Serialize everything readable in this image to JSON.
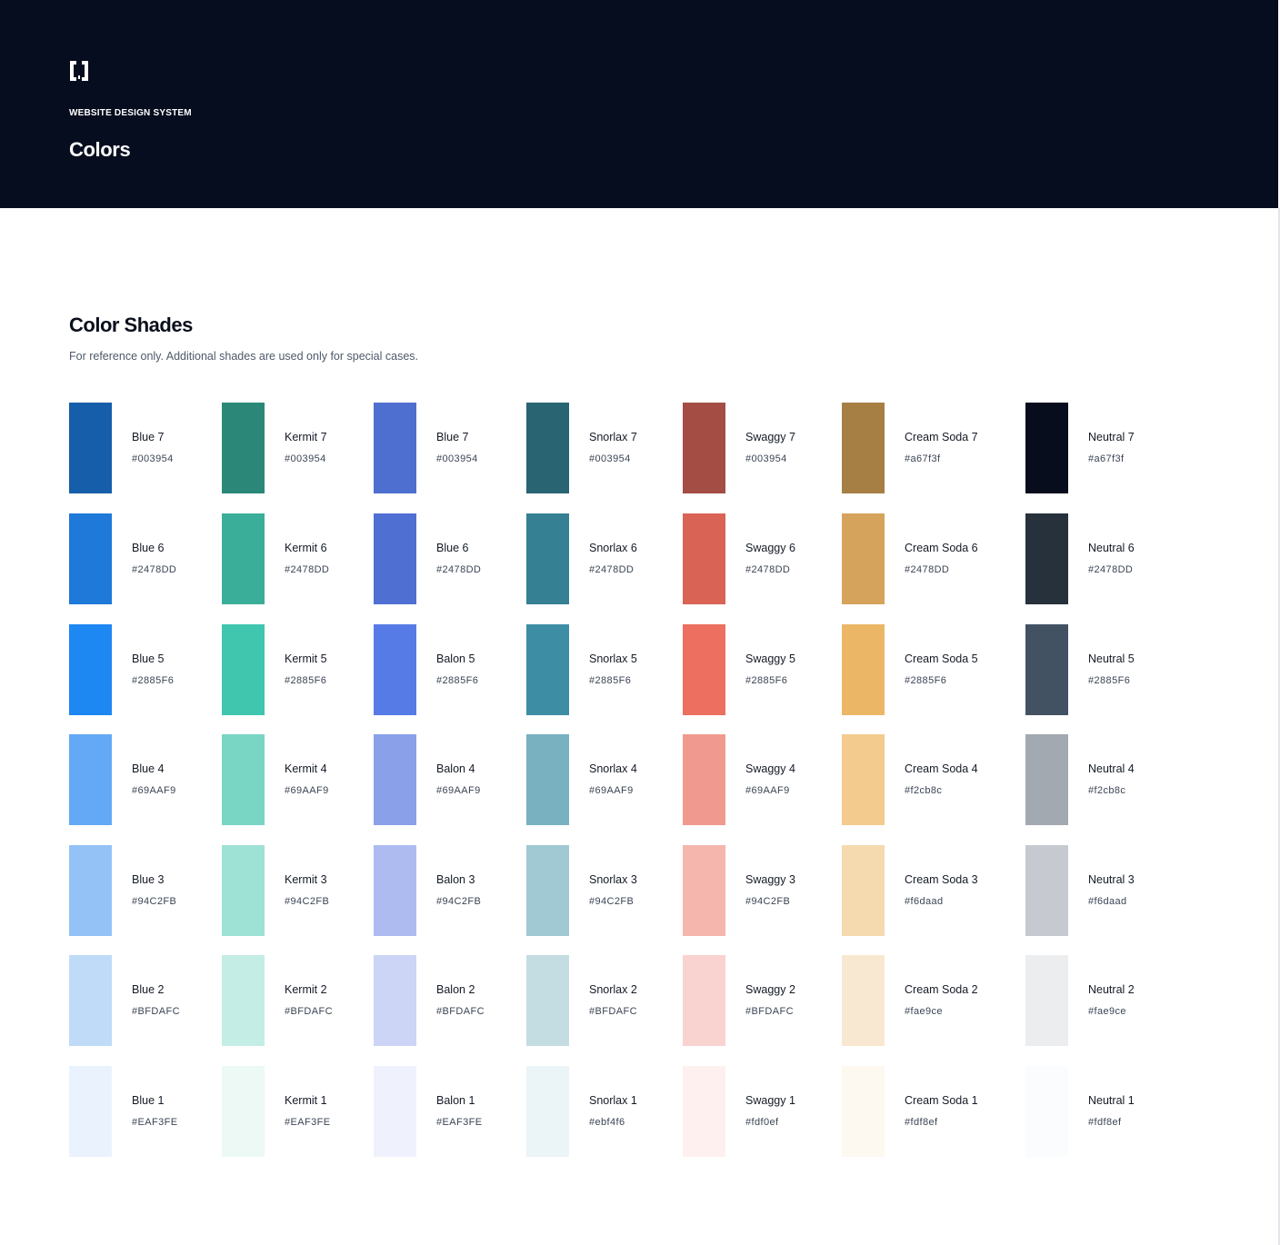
{
  "header": {
    "eyebrow": "WEBSITE DESIGN SYSTEM",
    "title": "Colors",
    "logo_icon": "brackets-logo-icon",
    "background_color": "#060d1f"
  },
  "section": {
    "title": "Color Shades",
    "description": "For reference only. Additional shades are used only for special cases."
  },
  "palette": {
    "columns": [
      {
        "family": "Blue",
        "shades": [
          {
            "name": "Blue 7",
            "hex": "#003954",
            "swatch_color": "#175EAA"
          },
          {
            "name": "Blue 6",
            "hex": "#2478DD",
            "swatch_color": "#1E79D8"
          },
          {
            "name": "Blue 5",
            "hex": "#2885F6",
            "swatch_color": "#1D87F2"
          },
          {
            "name": "Blue 4",
            "hex": "#69AAF9",
            "swatch_color": "#64A9F5"
          },
          {
            "name": "Blue 3",
            "hex": "#94C2FB",
            "swatch_color": "#94C2F7"
          },
          {
            "name": "Blue 2",
            "hex": "#BFDAFC",
            "swatch_color": "#C0DBF8"
          },
          {
            "name": "Blue 1",
            "hex": "#EAF3FE",
            "swatch_color": "#EAF3FD"
          }
        ]
      },
      {
        "family": "Kermit",
        "shades": [
          {
            "name": "Kermit 7",
            "hex": "#003954",
            "swatch_color": "#2B8878"
          },
          {
            "name": "Kermit 6",
            "hex": "#2478DD",
            "swatch_color": "#3BAE9A"
          },
          {
            "name": "Kermit 5",
            "hex": "#2885F6",
            "swatch_color": "#40C5AE"
          },
          {
            "name": "Kermit 4",
            "hex": "#69AAF9",
            "swatch_color": "#79D5C4"
          },
          {
            "name": "Kermit 3",
            "hex": "#94C2FB",
            "swatch_color": "#9EE2D5"
          },
          {
            "name": "Kermit 2",
            "hex": "#BFDAFC",
            "swatch_color": "#C4EDE5"
          },
          {
            "name": "Kermit 1",
            "hex": "#EAF3FE",
            "swatch_color": "#ECF9F5"
          }
        ]
      },
      {
        "family": "Balon",
        "shades": [
          {
            "name": "Blue 7",
            "hex": "#003954",
            "swatch_color": "#4F6FD0"
          },
          {
            "name": "Blue 6",
            "hex": "#2478DD",
            "swatch_color": "#4F6FD2"
          },
          {
            "name": "Balon 5",
            "hex": "#2885F6",
            "swatch_color": "#567AE6"
          },
          {
            "name": "Balon 4",
            "hex": "#69AAF9",
            "swatch_color": "#8AA1EA"
          },
          {
            "name": "Balon 3",
            "hex": "#94C2FB",
            "swatch_color": "#ADBBF1"
          },
          {
            "name": "Balon 2",
            "hex": "#BFDAFC",
            "swatch_color": "#CCD5F6"
          },
          {
            "name": "Balon 1",
            "hex": "#EAF3FE",
            "swatch_color": "#EFF2FC"
          }
        ]
      },
      {
        "family": "Snorlax",
        "shades": [
          {
            "name": "Snorlax 7",
            "hex": "#003954",
            "swatch_color": "#286472"
          },
          {
            "name": "Snorlax 6",
            "hex": "#2478DD",
            "swatch_color": "#358093"
          },
          {
            "name": "Snorlax 5",
            "hex": "#2885F6",
            "swatch_color": "#3D8DA4"
          },
          {
            "name": "Snorlax 4",
            "hex": "#69AAF9",
            "swatch_color": "#79B1C0"
          },
          {
            "name": "Snorlax 3",
            "hex": "#94C2FB",
            "swatch_color": "#A0C9D3"
          },
          {
            "name": "Snorlax 2",
            "hex": "#BFDAFC",
            "swatch_color": "#C4DDE3"
          },
          {
            "name": "Snorlax 1",
            "hex": "#ebf4f6",
            "swatch_color": "#EBF4F6"
          }
        ]
      },
      {
        "family": "Swaggy",
        "shades": [
          {
            "name": "Swaggy 7",
            "hex": "#003954",
            "swatch_color": "#A44D45"
          },
          {
            "name": "Swaggy 6",
            "hex": "#2478DD",
            "swatch_color": "#D96456"
          },
          {
            "name": "Swaggy 5",
            "hex": "#2885F6",
            "swatch_color": "#EC6F60"
          },
          {
            "name": "Swaggy 4",
            "hex": "#69AAF9",
            "swatch_color": "#F09A8F"
          },
          {
            "name": "Swaggy 3",
            "hex": "#94C2FB",
            "swatch_color": "#F5B6AD"
          },
          {
            "name": "Swaggy 2",
            "hex": "#BFDAFC",
            "swatch_color": "#F9D3D0"
          },
          {
            "name": "Swaggy 1",
            "hex": "#fdf0ef",
            "swatch_color": "#FDF0EF"
          }
        ]
      },
      {
        "family": "Cream Soda",
        "shades": [
          {
            "name": "Cream Soda 7",
            "hex": "#a67f3f",
            "swatch_color": "#A67F45"
          },
          {
            "name": "Cream Soda 6",
            "hex": "#2478DD",
            "swatch_color": "#D5A35B"
          },
          {
            "name": "Cream Soda 5",
            "hex": "#2885F6",
            "swatch_color": "#EBB766"
          },
          {
            "name": "Cream Soda 4",
            "hex": "#f2cb8c",
            "swatch_color": "#F3CB8F"
          },
          {
            "name": "Cream Soda 3",
            "hex": "#f6daad",
            "swatch_color": "#F6DAAF"
          },
          {
            "name": "Cream Soda 2",
            "hex": "#fae9ce",
            "swatch_color": "#F9E8D1"
          },
          {
            "name": "Cream Soda 1",
            "hex": "#fdf8ef",
            "swatch_color": "#FDF8F0"
          }
        ]
      },
      {
        "family": "Neutral",
        "shades": [
          {
            "name": "Neutral 7",
            "hex": "#a67f3f",
            "swatch_color": "#080D1E"
          },
          {
            "name": "Neutral 6",
            "hex": "#2478DD",
            "swatch_color": "#27313C"
          },
          {
            "name": "Neutral 5",
            "hex": "#2885F6",
            "swatch_color": "#435263"
          },
          {
            "name": "Neutral 4",
            "hex": "#f2cb8c",
            "swatch_color": "#A3A9B0"
          },
          {
            "name": "Neutral 3",
            "hex": "#f6daad",
            "swatch_color": "#C6CAD0"
          },
          {
            "name": "Neutral 2",
            "hex": "#fae9ce",
            "swatch_color": "#ECEDEF"
          },
          {
            "name": "Neutral 1",
            "hex": "#fdf8ef",
            "swatch_color": "#FBFCFD"
          }
        ]
      }
    ]
  }
}
